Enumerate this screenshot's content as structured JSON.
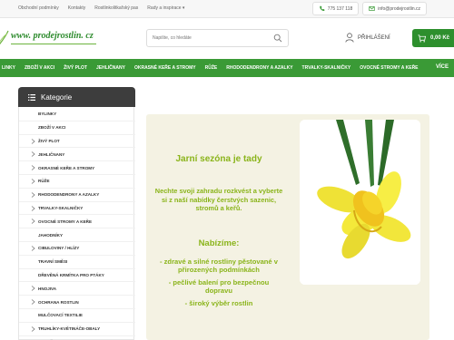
{
  "topbar": {
    "links": [
      "Obchodní podmínky",
      "Kontakty",
      "Rostlinkolitkařský pas",
      "Rady a inspirace"
    ],
    "phone": "775 137 118",
    "email": "info@prodejrostlin.cz"
  },
  "header": {
    "logo_text": "www. prodejrostlin. cz",
    "search_placeholder": "Napište, co hledáte",
    "login_label": "PŘIHLÁŠENÍ",
    "cart_label": "0,00 Kč"
  },
  "nav": {
    "items": [
      "LINKY",
      "ZBOŽÍ V AKCI",
      "ŽIVÝ PLOT",
      "JEHLIČNANY",
      "OKRASNÉ KEŘE A STROMY",
      "RŮŽE",
      "RHODODENDRONY A AZALKY",
      "TRVALKY-SKALNIČKY",
      "OVOCNÉ STROMY A KEŘE"
    ],
    "more_label": "VÍCE"
  },
  "sidebar": {
    "title": "Kategorie",
    "items": [
      {
        "label": "BYLINKY",
        "chevron": false
      },
      {
        "label": "ZBOŽÍ V AKCI",
        "chevron": false
      },
      {
        "label": "ŽIVÝ PLOT",
        "chevron": true
      },
      {
        "label": "JEHLIČNANY",
        "chevron": true
      },
      {
        "label": "OKRASNÉ KEŘE A STROMY",
        "chevron": true
      },
      {
        "label": "RŮŽE",
        "chevron": true
      },
      {
        "label": "RHODODENDRONY A AZALKY",
        "chevron": true
      },
      {
        "label": "TRVALKY-SKALNIČKY",
        "chevron": true
      },
      {
        "label": "OVOCNÉ STROMY A KEŘE",
        "chevron": true
      },
      {
        "label": "JAHODNÍKY",
        "chevron": false
      },
      {
        "label": "CIBULOVINY / HLÍZY",
        "chevron": true
      },
      {
        "label": "TRAVNÍ SMĚSI",
        "chevron": false
      },
      {
        "label": "DŘEVĚNÁ KRMÍTKA PRO PTÁKY",
        "chevron": false
      },
      {
        "label": "HNOJIVA",
        "chevron": true
      },
      {
        "label": "OCHRANA ROSTLIN",
        "chevron": true
      },
      {
        "label": "MULČOVACÍ TEXTILIE",
        "chevron": false
      },
      {
        "label": "TRUHLÍKY-KVĚTINÁČE-OBALY",
        "chevron": true
      },
      {
        "label": "PODPĚRY PRO ROSTLINY",
        "chevron": true
      }
    ]
  },
  "banner": {
    "title": "Jarní sezóna je tady",
    "text": "Nechte svoji zahradu rozkvést a vyberte si z naší nabídky čerstvých sazenic, stromů a keřů.",
    "subtitle": "Nabízíme:",
    "points": [
      "- zdravé a silné rostliny pěstované v přirozených podmínkách",
      "- pečlivé balení pro bezpečnou dopravu",
      "- široký výběr rostlin"
    ]
  },
  "colors": {
    "brand_green": "#3a9a36",
    "banner_text": "#8ab41a",
    "sidebar_header": "#3d3d3d"
  }
}
